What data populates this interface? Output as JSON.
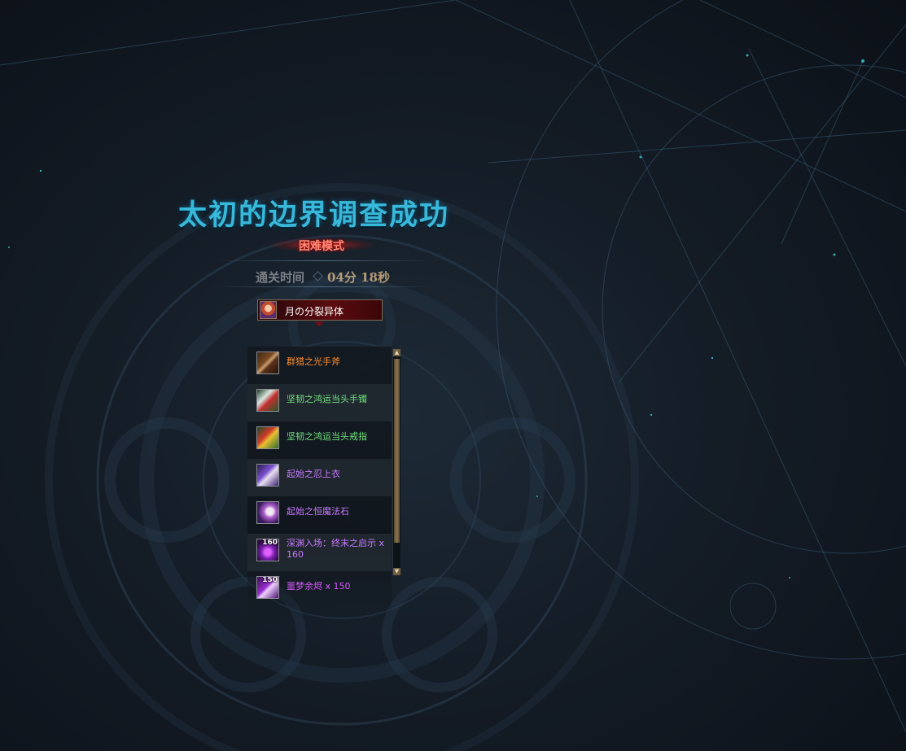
{
  "result": {
    "title": "太初的边界调查成功",
    "mode": "困难模式",
    "clear_time_label": "通关时间",
    "clear_time_value": "04分 18秒"
  },
  "boss": {
    "name": "月の分裂异体"
  },
  "rewards": [
    {
      "name": "群猎之光手斧",
      "color": "#ff8c2e",
      "icon": "hand-axe-icon",
      "count": ""
    },
    {
      "name": "坚韧之鸿运当头手镯",
      "color": "#71e27f",
      "icon": "bracelet-icon",
      "count": ""
    },
    {
      "name": "坚韧之鸿运当头戒指",
      "color": "#71e27f",
      "icon": "ring-icon",
      "count": ""
    },
    {
      "name": "起始之忍上衣",
      "color": "#c87bff",
      "icon": "ninja-top-icon",
      "count": ""
    },
    {
      "name": "起始之恒魔法石",
      "color": "#c87bff",
      "icon": "magic-stone-icon",
      "count": ""
    },
    {
      "name": "深渊入场：终末之启示 x 160",
      "color": "#c87bff",
      "icon": "abyss-ticket-icon",
      "count": "160"
    },
    {
      "name": "噩梦余烬 x 150",
      "color": "#d85bff",
      "icon": "nightmare-ember-icon",
      "count": "150"
    }
  ],
  "colors": {
    "title": "#39b9da",
    "mode": "#ff8a76",
    "time_value": "#b59c77",
    "epic_orange": "#ff8c2e",
    "green": "#71e27f",
    "purple": "#c87bff"
  }
}
